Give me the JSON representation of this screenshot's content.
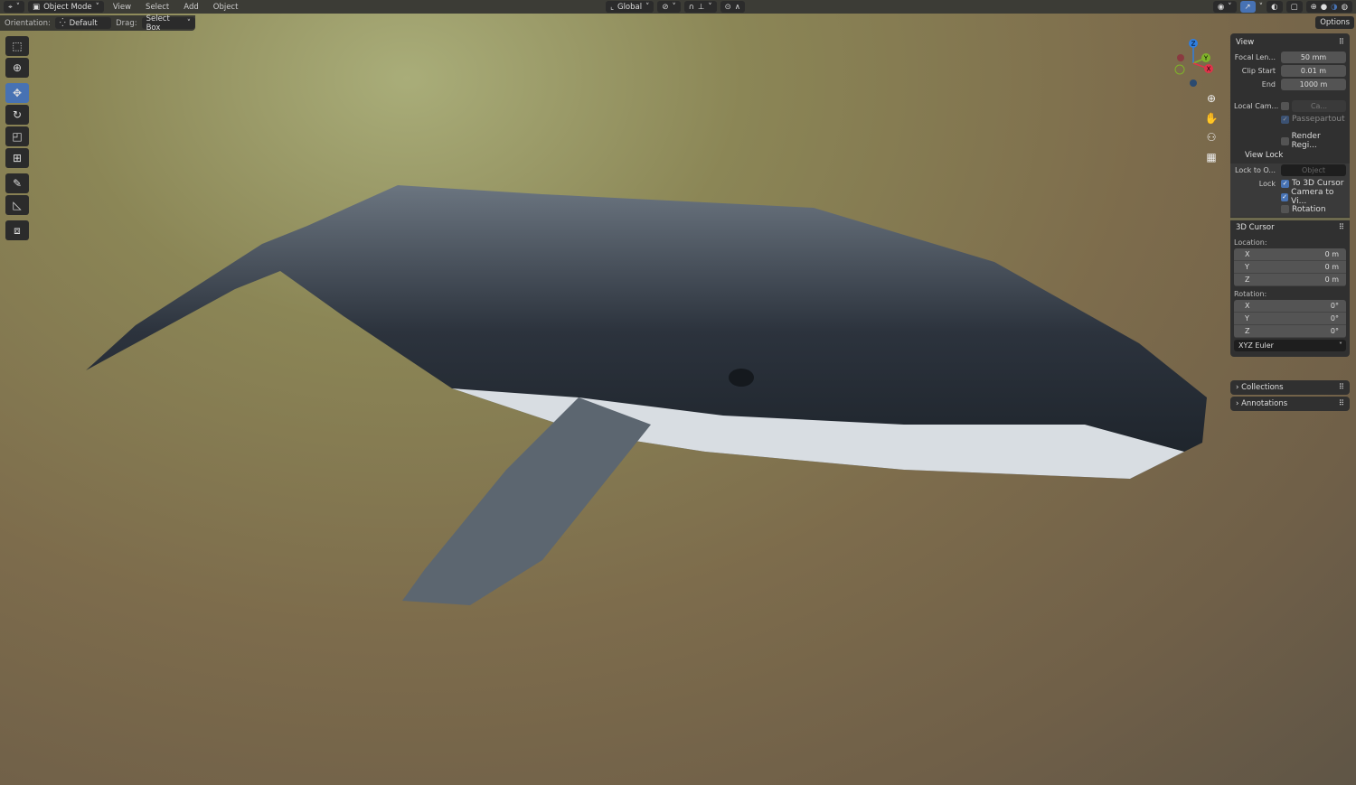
{
  "topbar": {
    "editor_icon": "3d-viewport-icon",
    "mode": "Object Mode",
    "menus": [
      "View",
      "Select",
      "Add",
      "Object"
    ],
    "transform": "Global",
    "options": "Options"
  },
  "header2": {
    "orientation_label": "Orientation:",
    "orientation": "Default",
    "drag_label": "Drag:",
    "drag": "Select Box"
  },
  "tools": [
    "select-box",
    "cursor",
    "move",
    "rotate",
    "scale",
    "transform",
    "annotate",
    "measure",
    "add-cube"
  ],
  "gizmo": {
    "x": "X",
    "y": "Y",
    "z": "Z"
  },
  "panel": {
    "view": {
      "title": "View",
      "focal_label": "Focal Len...",
      "focal": "50 mm",
      "clip_start_label": "Clip Start",
      "clip_start": "0.01 m",
      "end_label": "End",
      "end": "1000 m",
      "local_cam_label": "Local Cam...",
      "local_cam": "Ca...",
      "passepartout": "Passepartout",
      "render_region": "Render Regi..."
    },
    "view_lock": {
      "title": "View Lock",
      "lock_to_label": "Lock to O...",
      "lock_to": "Object",
      "lock_label": "Lock",
      "to_cursor": "To 3D Cursor",
      "camera_to_view": "Camera to Vi...",
      "rotation": "Rotation"
    },
    "cursor": {
      "title": "3D Cursor",
      "location_label": "Location:",
      "location": [
        {
          "axis": "X",
          "value": "0 m"
        },
        {
          "axis": "Y",
          "value": "0 m"
        },
        {
          "axis": "Z",
          "value": "0 m"
        }
      ],
      "rotation_label": "Rotation:",
      "rotation": [
        {
          "axis": "X",
          "value": "0°"
        },
        {
          "axis": "Y",
          "value": "0°"
        },
        {
          "axis": "Z",
          "value": "0°"
        }
      ],
      "mode": "XYZ Euler"
    },
    "collections": "Collections",
    "annotations": "Annotations"
  }
}
